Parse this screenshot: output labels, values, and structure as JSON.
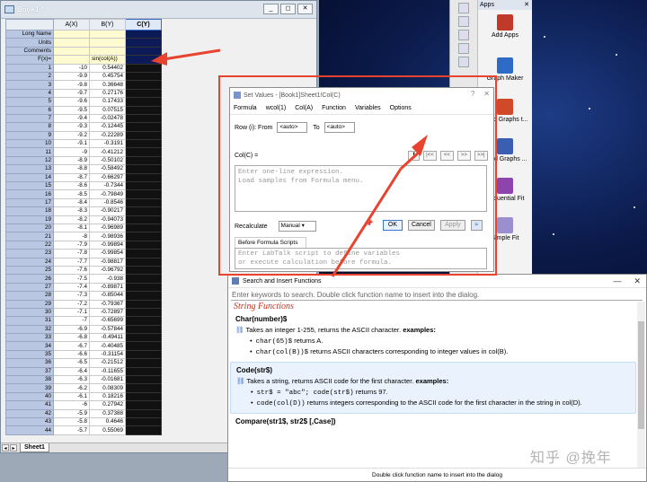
{
  "book": {
    "title": "Book1 *",
    "winbtns": [
      "_",
      "◻",
      "✕"
    ],
    "columns": [
      "A(X)",
      "B(Y)",
      "C(Y)"
    ],
    "meta_rows": [
      {
        "label": "Long Name",
        "a": "",
        "b": ""
      },
      {
        "label": "Units",
        "a": "",
        "b": ""
      },
      {
        "label": "Comments",
        "a": "",
        "b": ""
      },
      {
        "label": "F(x)=",
        "a": "",
        "b": "sin(col(A))"
      }
    ],
    "rows": [
      [
        "1",
        "-10",
        "0.54402"
      ],
      [
        "2",
        "-9.9",
        "0.45754"
      ],
      [
        "3",
        "-9.8",
        "0.36648"
      ],
      [
        "4",
        "-9.7",
        "0.27176"
      ],
      [
        "5",
        "-9.6",
        "0.17433"
      ],
      [
        "6",
        "-9.5",
        "0.07515"
      ],
      [
        "7",
        "-9.4",
        "-0.02478"
      ],
      [
        "8",
        "-9.3",
        "-0.12445"
      ],
      [
        "9",
        "-9.2",
        "-0.22289"
      ],
      [
        "10",
        "-9.1",
        "-0.3191"
      ],
      [
        "11",
        "-9",
        "-0.41212"
      ],
      [
        "12",
        "-8.9",
        "-0.50102"
      ],
      [
        "13",
        "-8.8",
        "-0.58492"
      ],
      [
        "14",
        "-8.7",
        "-0.66297"
      ],
      [
        "15",
        "-8.6",
        "-0.7344"
      ],
      [
        "16",
        "-8.5",
        "-0.79849"
      ],
      [
        "17",
        "-8.4",
        "-0.8546"
      ],
      [
        "18",
        "-8.3",
        "-0.90217"
      ],
      [
        "19",
        "-8.2",
        "-0.94073"
      ],
      [
        "20",
        "-8.1",
        "-0.96989"
      ],
      [
        "21",
        "-8",
        "-0.98936"
      ],
      [
        "22",
        "-7.9",
        "-0.99894"
      ],
      [
        "23",
        "-7.8",
        "-0.99854"
      ],
      [
        "24",
        "-7.7",
        "-0.98817"
      ],
      [
        "25",
        "-7.6",
        "-0.96792"
      ],
      [
        "26",
        "-7.5",
        "-0.938"
      ],
      [
        "27",
        "-7.4",
        "-0.89871"
      ],
      [
        "28",
        "-7.3",
        "-0.85044"
      ],
      [
        "29",
        "-7.2",
        "-0.79367"
      ],
      [
        "30",
        "-7.1",
        "-0.72897"
      ],
      [
        "31",
        "-7",
        "-0.65699"
      ],
      [
        "32",
        "-6.9",
        "-0.57844"
      ],
      [
        "33",
        "-6.8",
        "-0.49411"
      ],
      [
        "34",
        "-6.7",
        "-0.40485"
      ],
      [
        "35",
        "-6.6",
        "-0.31154"
      ],
      [
        "36",
        "-6.5",
        "-0.21512"
      ],
      [
        "37",
        "-6.4",
        "-0.11655"
      ],
      [
        "38",
        "-6.3",
        "-0.01681"
      ],
      [
        "39",
        "-6.2",
        "0.08309"
      ],
      [
        "40",
        "-6.1",
        "0.18216"
      ],
      [
        "41",
        "-6",
        "0.27942"
      ],
      [
        "42",
        "-5.9",
        "0.37388"
      ],
      [
        "43",
        "-5.8",
        "0.4646"
      ],
      [
        "44",
        "-5.7",
        "0.55069"
      ]
    ],
    "sheet_tab": "Sheet1",
    "tab_nav": [
      "◂",
      "▸"
    ]
  },
  "apps": {
    "title": "Apps",
    "close": "✕",
    "items": [
      "Add Apps",
      "Graph Maker",
      "Send Graphs t...",
      "Send Graphs ...",
      "Sequential Fit",
      "Simple Fit"
    ],
    "icon_colors": [
      "#c0392b",
      "#2e6bc6",
      "#d04a2a",
      "#3a5fb0",
      "#8e44ad",
      "#9b8fd0"
    ]
  },
  "set_values": {
    "title": "Set Values - [Book1]Sheet1!Col(C)",
    "ctrls": [
      "?",
      "✕"
    ],
    "menu": [
      "Formula",
      "wcol(1)",
      "Col(A)",
      "Function",
      "Variables",
      "Options"
    ],
    "row_label": "Row (i): From",
    "from_value": "<auto>",
    "to_label": "To",
    "to_value": "<auto>",
    "col_label": "Col(C) =",
    "nav": [
      "|<<",
      "<<",
      ">>",
      ">>|"
    ],
    "formula_placeholder_1": "Enter one-line expression.",
    "formula_placeholder_2": "Load samples from Formula menu.",
    "recalc_label": "Recalculate",
    "recalc_value": "Manual",
    "ok": "OK",
    "cancel": "Cancel",
    "apply": "Apply",
    "before_tab": "Before Formula Scripts",
    "script_placeholder_1": "Enter LabTalk script to define variables",
    "script_placeholder_2": "or execute calculation before formula."
  },
  "search_functions": {
    "title": "Search and Insert Functions",
    "ctrls": [
      "—",
      "✕"
    ],
    "search_placeholder": "Enter keywords to search. Double click function name to insert into the dialog.",
    "category": "String Functions",
    "functions": [
      {
        "name": "Char(number)$",
        "desc": "Takes an integer 1-255, returns the ASCII character.",
        "examples_label": "examples:",
        "examples": [
          {
            "code": "char(65)$",
            "text": "returns A."
          },
          {
            "code": "char(col(B))$",
            "text": "returns ASCII characters corresponding to integer values in col(B)."
          }
        ]
      },
      {
        "name": "Code(str$)",
        "desc": "Takes a string, returns ASCII code for the first character.",
        "examples_label": "examples:",
        "examples": [
          {
            "code": "str$ = \"abc\"; code(str$)",
            "text": "returns 97."
          },
          {
            "code": "code(col(D))",
            "text": "returns integers corresponding to the ASCII code for the first character in the string in col(D)."
          }
        ]
      },
      {
        "name": "Compare(str1$, str2$ [,Case])"
      }
    ],
    "status": "Double click function name to insert into the dialog"
  },
  "watermark": "知乎 @挽年"
}
